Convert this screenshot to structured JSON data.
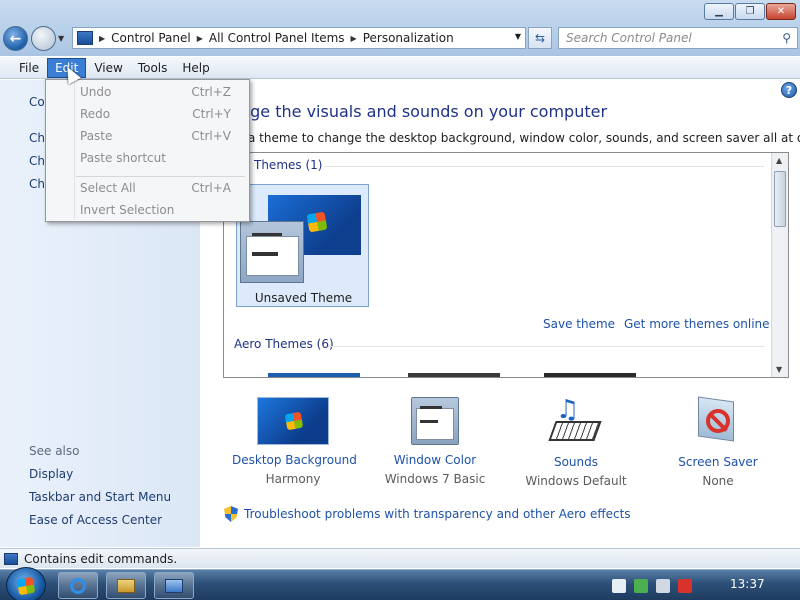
{
  "window": {
    "controls": [
      "minimize",
      "maximize",
      "close"
    ]
  },
  "address": {
    "crumbs": [
      "Control Panel",
      "All Control Panel Items",
      "Personalization"
    ],
    "search_placeholder": "Search Control Panel"
  },
  "menubar": {
    "items": [
      "File",
      "Edit",
      "View",
      "Tools",
      "Help"
    ],
    "active": "Edit"
  },
  "edit_menu": {
    "items": [
      {
        "label": "Undo",
        "shortcut": "Ctrl+Z",
        "enabled": false
      },
      {
        "label": "Redo",
        "shortcut": "Ctrl+Y",
        "enabled": false
      },
      {
        "label": "Paste",
        "shortcut": "Ctrl+V",
        "enabled": false
      },
      {
        "label": "Paste shortcut",
        "shortcut": "",
        "enabled": false
      },
      {
        "label": "Select All",
        "shortcut": "Ctrl+A",
        "enabled": false
      },
      {
        "label": "Invert Selection",
        "shortcut": "",
        "enabled": false
      }
    ]
  },
  "leftpane": {
    "partial_items": [
      "Co",
      "Ch",
      "Ch",
      "Ch"
    ],
    "see_also_label": "See also",
    "see_also": [
      "Display",
      "Taskbar and Start Menu",
      "Ease of Access Center"
    ]
  },
  "main": {
    "heading": "nge the visuals and sounds on your computer",
    "subtext": "a theme to change the desktop background, window color, sounds, and screen saver all at once.",
    "my_themes_caption": "Themes (1)",
    "unsaved_theme": "Unsaved Theme",
    "save_theme": "Save theme",
    "get_more_themes": "Get more themes online",
    "aero_caption": "Aero Themes (6)",
    "settings": [
      {
        "title": "Desktop Background",
        "value": "Harmony",
        "icon": "desktop-background-icon"
      },
      {
        "title": "Window Color",
        "value": "Windows 7 Basic",
        "icon": "window-color-icon"
      },
      {
        "title": "Sounds",
        "value": "Windows Default",
        "icon": "sounds-icon"
      },
      {
        "title": "Screen Saver",
        "value": "None",
        "icon": "screen-saver-icon"
      }
    ],
    "troubleshoot": "Troubleshoot problems with transparency and other Aero effects"
  },
  "statusbar": {
    "text": "Contains edit commands."
  },
  "taskbar": {
    "clock": "13:37"
  },
  "colors": {
    "accent": "#3a7fd4",
    "link": "#1e52a8",
    "heading": "#1e3287"
  }
}
